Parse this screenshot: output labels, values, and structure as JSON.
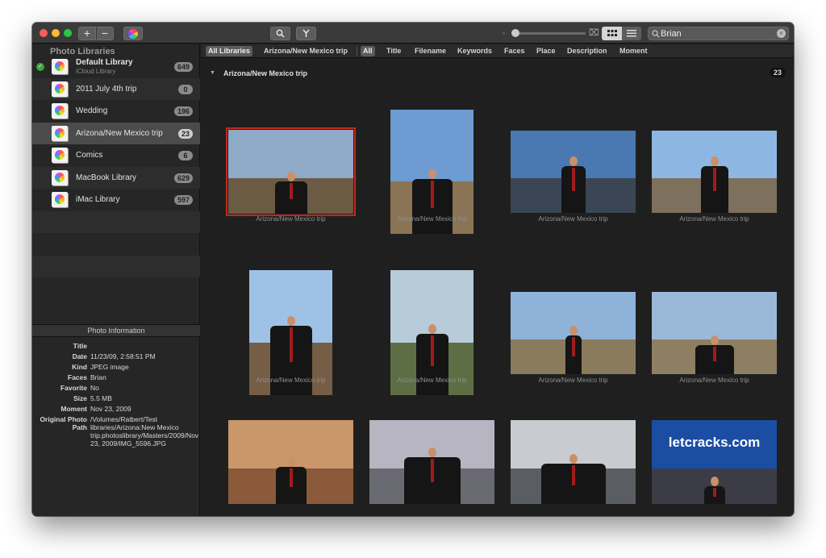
{
  "toolbar": {
    "add_label": "+",
    "remove_label": "−",
    "search": {
      "value": "Brian",
      "placeholder": ""
    }
  },
  "sidebar": {
    "header": "Photo Libraries",
    "libraries": [
      {
        "name": "Default Library",
        "sub": "iCloud Library",
        "count": "649",
        "default": true,
        "selected": false
      },
      {
        "name": "2011 July 4th trip",
        "count": "0",
        "selected": false
      },
      {
        "name": "Wedding",
        "count": "196",
        "selected": false
      },
      {
        "name": "Arizona/New Mexico trip",
        "count": "23",
        "selected": true
      },
      {
        "name": "Comics",
        "count": "6",
        "selected": false
      },
      {
        "name": "MacBook Library",
        "count": "629",
        "selected": false
      },
      {
        "name": "iMac Library",
        "count": "597",
        "selected": false
      }
    ]
  },
  "info": {
    "header": "Photo Information",
    "rows": [
      {
        "key": "Title",
        "value": ""
      },
      {
        "key": "Date",
        "value": "11/23/09, 2:58:51 PM"
      },
      {
        "key": "Kind",
        "value": "JPEG image"
      },
      {
        "key": "Faces",
        "value": "Brian"
      },
      {
        "key": "Favorite",
        "value": "No"
      },
      {
        "key": "Size",
        "value": "5.5 MB"
      },
      {
        "key": "Moment",
        "value": "Nov 23, 2009"
      },
      {
        "key": "Original Photo Path",
        "value": "/Volumes/Ratbert/Test libraries/Arizona:New Mexico trip.photoslibrary/Masters/2009/Nov 23, 2009/IMG_5596.JPG"
      }
    ]
  },
  "filters": {
    "scope": [
      "All Libraries",
      "Arizona/New Mexico trip"
    ],
    "fields": [
      "All",
      "Title",
      "Filename",
      "Keywords",
      "Faces",
      "Place",
      "Description",
      "Moment"
    ]
  },
  "section": {
    "title": "Arizona/New Mexico trip",
    "count": "23"
  },
  "photos": [
    {
      "caption": "Arizona/New Mexico trip",
      "selected": true
    },
    {
      "caption": "Arizona/New Mexico trip"
    },
    {
      "caption": "Arizona/New Mexico trip"
    },
    {
      "caption": "Arizona/New Mexico trip"
    },
    {
      "caption": "Arizona/New Mexico trip"
    },
    {
      "caption": "Arizona/New Mexico trip"
    },
    {
      "caption": "Arizona/New Mexico trip"
    },
    {
      "caption": "Arizona/New Mexico trip"
    },
    {
      "caption": ""
    },
    {
      "caption": ""
    },
    {
      "caption": ""
    },
    {
      "caption": "",
      "watermark": "letcracks.com"
    }
  ],
  "colors": {
    "selection": "#c2281f",
    "default_check": "#3fa33c"
  }
}
